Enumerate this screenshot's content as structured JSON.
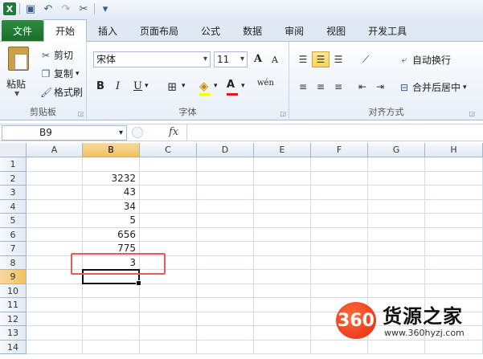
{
  "app": {
    "logo_letter": "X"
  },
  "tabs": [
    {
      "label": "文件"
    },
    {
      "label": "开始"
    },
    {
      "label": "插入"
    },
    {
      "label": "页面布局"
    },
    {
      "label": "公式"
    },
    {
      "label": "数据"
    },
    {
      "label": "审阅"
    },
    {
      "label": "视图"
    },
    {
      "label": "开发工具"
    }
  ],
  "clipboard": {
    "paste": "粘贴",
    "cut": "剪切",
    "copy": "复制",
    "format_painter": "格式刷",
    "group_label": "剪贴板"
  },
  "font": {
    "name": "宋体",
    "size": "11",
    "bold": "B",
    "italic": "I",
    "underline": "U",
    "grow": "A",
    "shrink": "A",
    "color": "A",
    "wen": "wén",
    "group_label": "字体"
  },
  "alignment": {
    "wrap": "自动换行",
    "merge": "合并后居中",
    "group_label": "对齐方式"
  },
  "formula_bar": {
    "name_box": "B9",
    "fx": "fx",
    "content": ""
  },
  "sheet": {
    "columns": [
      "A",
      "B",
      "C",
      "D",
      "E",
      "F",
      "G",
      "H"
    ],
    "rows": [
      "1",
      "2",
      "3",
      "4",
      "5",
      "6",
      "7",
      "8",
      "9",
      "10",
      "11",
      "12",
      "13",
      "14"
    ],
    "b_values": [
      "",
      "3232",
      "43",
      "34",
      "5",
      "656",
      "775",
      "3",
      "",
      "",
      "",
      "",
      "",
      ""
    ],
    "selected_column": "B",
    "selected_row": "9"
  },
  "watermark": {
    "badge": "360",
    "title": "货源之家",
    "url": "www.360hyzj.com"
  }
}
